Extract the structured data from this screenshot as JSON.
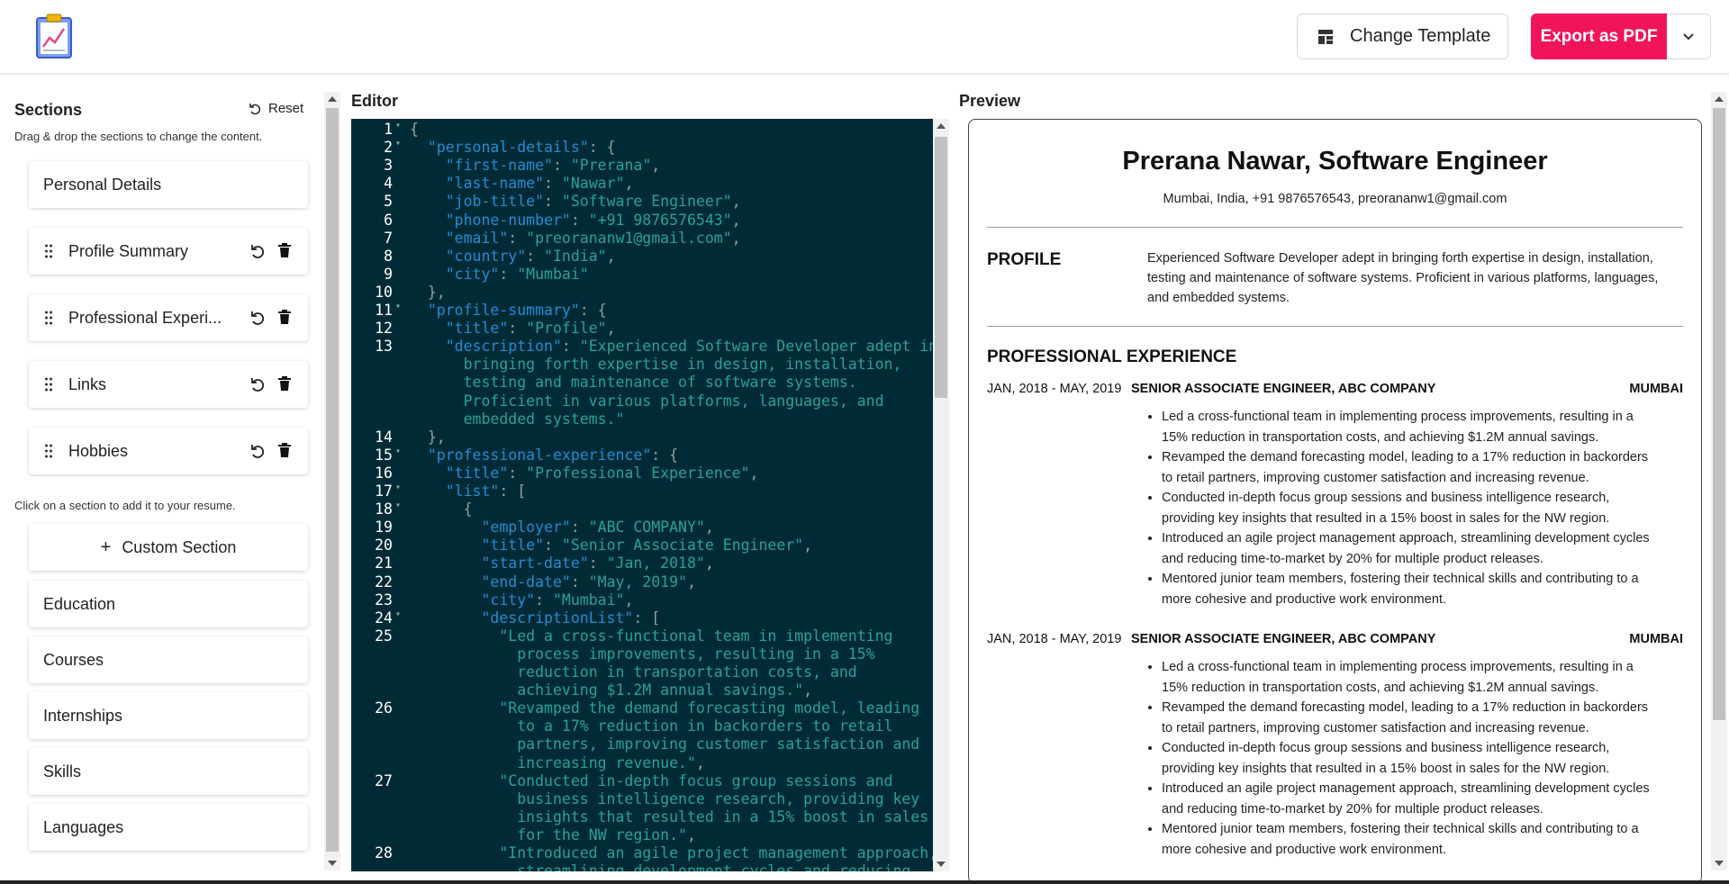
{
  "topbar": {
    "change_template_label": "Change Template",
    "export_label": "Export as PDF",
    "brand_color": "#f0145a"
  },
  "sidebar": {
    "title": "Sections",
    "reset_label": "Reset",
    "drag_hint": "Drag & drop the sections to change the content.",
    "click_hint": "Click on a section to add it to your resume.",
    "active_sections": [
      {
        "label": "Personal Details"
      },
      {
        "label": "Profile Summary"
      },
      {
        "label": "Professional Experi..."
      },
      {
        "label": "Links"
      },
      {
        "label": "Hobbies"
      }
    ],
    "custom_section_label": "Custom Section",
    "available_sections": [
      {
        "label": "Education"
      },
      {
        "label": "Courses"
      },
      {
        "label": "Internships"
      },
      {
        "label": "Skills"
      },
      {
        "label": "Languages"
      }
    ]
  },
  "editor": {
    "title": "Editor",
    "lines": [
      {
        "n": "1",
        "fold": true,
        "html": "<span class='p'>{</span>"
      },
      {
        "n": "2",
        "fold": true,
        "html": "  <span class='k'>\"personal-details\"</span><span class='p'>: {</span>"
      },
      {
        "n": "3",
        "html": "    <span class='k'>\"first-name\"</span><span class='p'>: </span><span class='s'>\"Prerana\"</span><span class='p'>,</span>"
      },
      {
        "n": "4",
        "html": "    <span class='k'>\"last-name\"</span><span class='p'>: </span><span class='s'>\"Nawar\"</span><span class='p'>,</span>"
      },
      {
        "n": "5",
        "html": "    <span class='k'>\"job-title\"</span><span class='p'>: </span><span class='s'>\"Software Engineer\"</span><span class='p'>,</span>"
      },
      {
        "n": "6",
        "html": "    <span class='k'>\"phone-number\"</span><span class='p'>: </span><span class='s'>\"+91 9876576543\"</span><span class='p'>,</span>"
      },
      {
        "n": "7",
        "html": "    <span class='k'>\"email\"</span><span class='p'>: </span><span class='s'>\"preorananw1@gmail.com\"</span><span class='p'>,</span>"
      },
      {
        "n": "8",
        "html": "    <span class='k'>\"country\"</span><span class='p'>: </span><span class='s'>\"India\"</span><span class='p'>,</span>"
      },
      {
        "n": "9",
        "html": "    <span class='k'>\"city\"</span><span class='p'>: </span><span class='s'>\"Mumbai\"</span>"
      },
      {
        "n": "10",
        "html": "  <span class='p'>},</span>"
      },
      {
        "n": "11",
        "fold": true,
        "html": "  <span class='k'>\"profile-summary\"</span><span class='p'>: {</span>"
      },
      {
        "n": "12",
        "html": "    <span class='k'>\"title\"</span><span class='p'>: </span><span class='s'>\"Profile\"</span><span class='p'>,</span>"
      },
      {
        "n": "13",
        "html": "    <span class='k'>\"description\"</span><span class='p'>: </span><span class='s'>\"Experienced Software Developer adept in</span>"
      },
      {
        "n": "",
        "html": "      <span class='s'>bringing forth expertise in design, installation,</span>"
      },
      {
        "n": "",
        "html": "      <span class='s'>testing and maintenance of software systems.</span>"
      },
      {
        "n": "",
        "html": "      <span class='s'>Proficient in various platforms, languages, and</span>"
      },
      {
        "n": "",
        "html": "      <span class='s'>embedded systems.\"</span>"
      },
      {
        "n": "14",
        "html": "  <span class='p'>},</span>"
      },
      {
        "n": "15",
        "fold": true,
        "html": "  <span class='k'>\"professional-experience\"</span><span class='p'>: {</span>"
      },
      {
        "n": "16",
        "html": "    <span class='k'>\"title\"</span><span class='p'>: </span><span class='s'>\"Professional Experience\"</span><span class='p'>,</span>"
      },
      {
        "n": "17",
        "fold": true,
        "html": "    <span class='k'>\"list\"</span><span class='p'>: [</span>"
      },
      {
        "n": "18",
        "fold": true,
        "html": "      <span class='p'>{</span>"
      },
      {
        "n": "19",
        "html": "        <span class='k'>\"employer\"</span><span class='p'>: </span><span class='s'>\"ABC COMPANY\"</span><span class='p'>,</span>"
      },
      {
        "n": "20",
        "html": "        <span class='k'>\"title\"</span><span class='p'>: </span><span class='s'>\"Senior Associate Engineer\"</span><span class='p'>,</span>"
      },
      {
        "n": "21",
        "html": "        <span class='k'>\"start-date\"</span><span class='p'>: </span><span class='s'>\"Jan, 2018\"</span><span class='p'>,</span>"
      },
      {
        "n": "22",
        "html": "        <span class='k'>\"end-date\"</span><span class='p'>: </span><span class='s'>\"May, 2019\"</span><span class='p'>,</span>"
      },
      {
        "n": "23",
        "html": "        <span class='k'>\"city\"</span><span class='p'>: </span><span class='s'>\"Mumbai\"</span><span class='p'>,</span>"
      },
      {
        "n": "24",
        "fold": true,
        "html": "        <span class='k'>\"descriptionList\"</span><span class='p'>: [</span>"
      },
      {
        "n": "25",
        "html": "          <span class='s'>\"Led a cross-functional team in implementing</span>"
      },
      {
        "n": "",
        "html": "            <span class='s'>process improvements, resulting in a 15%</span>"
      },
      {
        "n": "",
        "html": "            <span class='s'>reduction in transportation costs, and</span>"
      },
      {
        "n": "",
        "html": "            <span class='s'>achieving $1.2M annual savings.\"</span><span class='p'>,</span>"
      },
      {
        "n": "26",
        "html": "          <span class='s'>\"Revamped the demand forecasting model, leading</span>"
      },
      {
        "n": "",
        "html": "            <span class='s'>to a 17% reduction in backorders to retail</span>"
      },
      {
        "n": "",
        "html": "            <span class='s'>partners, improving customer satisfaction and</span>"
      },
      {
        "n": "",
        "html": "            <span class='s'>increasing revenue.\"</span><span class='p'>,</span>"
      },
      {
        "n": "27",
        "html": "          <span class='s'>\"Conducted in-depth focus group sessions and</span>"
      },
      {
        "n": "",
        "html": "            <span class='s'>business intelligence research, providing key</span>"
      },
      {
        "n": "",
        "html": "            <span class='s'>insights that resulted in a 15% boost in sales</span>"
      },
      {
        "n": "",
        "html": "            <span class='s'>for the NW region.\"</span><span class='p'>,</span>"
      },
      {
        "n": "28",
        "html": "          <span class='s'>\"Introduced an agile project management approach,</span>"
      },
      {
        "n": "",
        "html": "            <span class='s'>streamlining development cycles and reducing</span>"
      }
    ]
  },
  "preview": {
    "title": "Preview",
    "name_line": "Prerana Nawar, Software Engineer",
    "contact_line": "Mumbai, India, +91 9876576543, preorananw1@gmail.com",
    "profile_heading": "PROFILE",
    "profile_text": "Experienced Software Developer adept in bringing forth expertise in design, installation, testing and maintenance of software systems. Proficient in various platforms, languages, and embedded systems.",
    "experience_heading": "PROFESSIONAL EXPERIENCE",
    "jobs": [
      {
        "dates": "JAN, 2018 - MAY, 2019",
        "role": "SENIOR ASSOCIATE ENGINEER, ABC COMPANY",
        "city": "MUMBAI",
        "bullets": [
          "Led a cross-functional team in implementing process improvements, resulting in a 15% reduction in transportation costs, and achieving $1.2M annual savings.",
          "Revamped the demand forecasting model, leading to a 17% reduction in backorders to retail partners, improving customer satisfaction and increasing revenue.",
          "Conducted in-depth focus group sessions and business intelligence research, providing key insights that resulted in a 15% boost in sales for the NW region.",
          "Introduced an agile project management approach, streamlining development cycles and reducing time-to-market by 20% for multiple product releases.",
          "Mentored junior team members, fostering their technical skills and contributing to a more cohesive and productive work environment."
        ]
      },
      {
        "dates": "JAN, 2018 - MAY, 2019",
        "role": "SENIOR ASSOCIATE ENGINEER, ABC COMPANY",
        "city": "MUMBAI",
        "bullets": [
          "Led a cross-functional team in implementing process improvements, resulting in a 15% reduction in transportation costs, and achieving $1.2M annual savings.",
          "Revamped the demand forecasting model, leading to a 17% reduction in backorders to retail partners, improving customer satisfaction and increasing revenue.",
          "Conducted in-depth focus group sessions and business intelligence research, providing key insights that resulted in a 15% boost in sales for the NW region.",
          "Introduced an agile project management approach, streamlining development cycles and reducing time-to-market by 20% for multiple product releases.",
          "Mentored junior team members, fostering their technical skills and contributing to a more cohesive and productive work environment."
        ]
      }
    ]
  }
}
